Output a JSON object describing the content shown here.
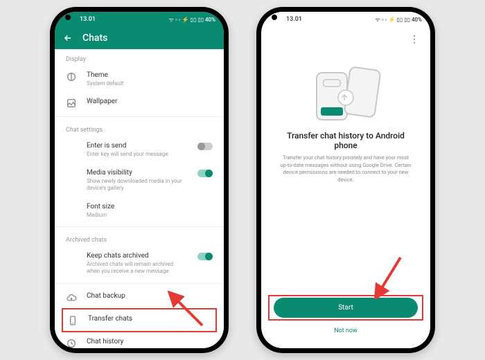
{
  "status": {
    "time": "13.01",
    "indicators": "ᯤ ▫ ◦ ⚡ ▯▯ ▯▯ 40%"
  },
  "phone1": {
    "header": "Chats",
    "section_display": "Display",
    "theme": {
      "label": "Theme",
      "sub": "System default"
    },
    "wallpaper": {
      "label": "Wallpaper"
    },
    "section_chat": "Chat settings",
    "enter": {
      "label": "Enter is send",
      "sub": "Enter key will send your message"
    },
    "media": {
      "label": "Media visibility",
      "sub": "Show newly downloaded media in your device's gallery"
    },
    "font": {
      "label": "Font size",
      "sub": "Medium"
    },
    "section_arch": "Archived chats",
    "keep": {
      "label": "Keep chats archived",
      "sub": "Archived chats will remain archived when you receive a new message"
    },
    "backup": {
      "label": "Chat backup"
    },
    "transfer": {
      "label": "Transfer chats"
    },
    "history": {
      "label": "Chat history"
    }
  },
  "phone2": {
    "title": "Transfer chat history to Android phone",
    "desc": "Transfer your chat history privately and have your most up-to-date messages without using Google Drive. Certain device permissions are needed to connect to your new device.",
    "start": "Start",
    "notnow": "Not now"
  },
  "colors": {
    "teal": "#0b8a72",
    "red": "#e53935"
  }
}
